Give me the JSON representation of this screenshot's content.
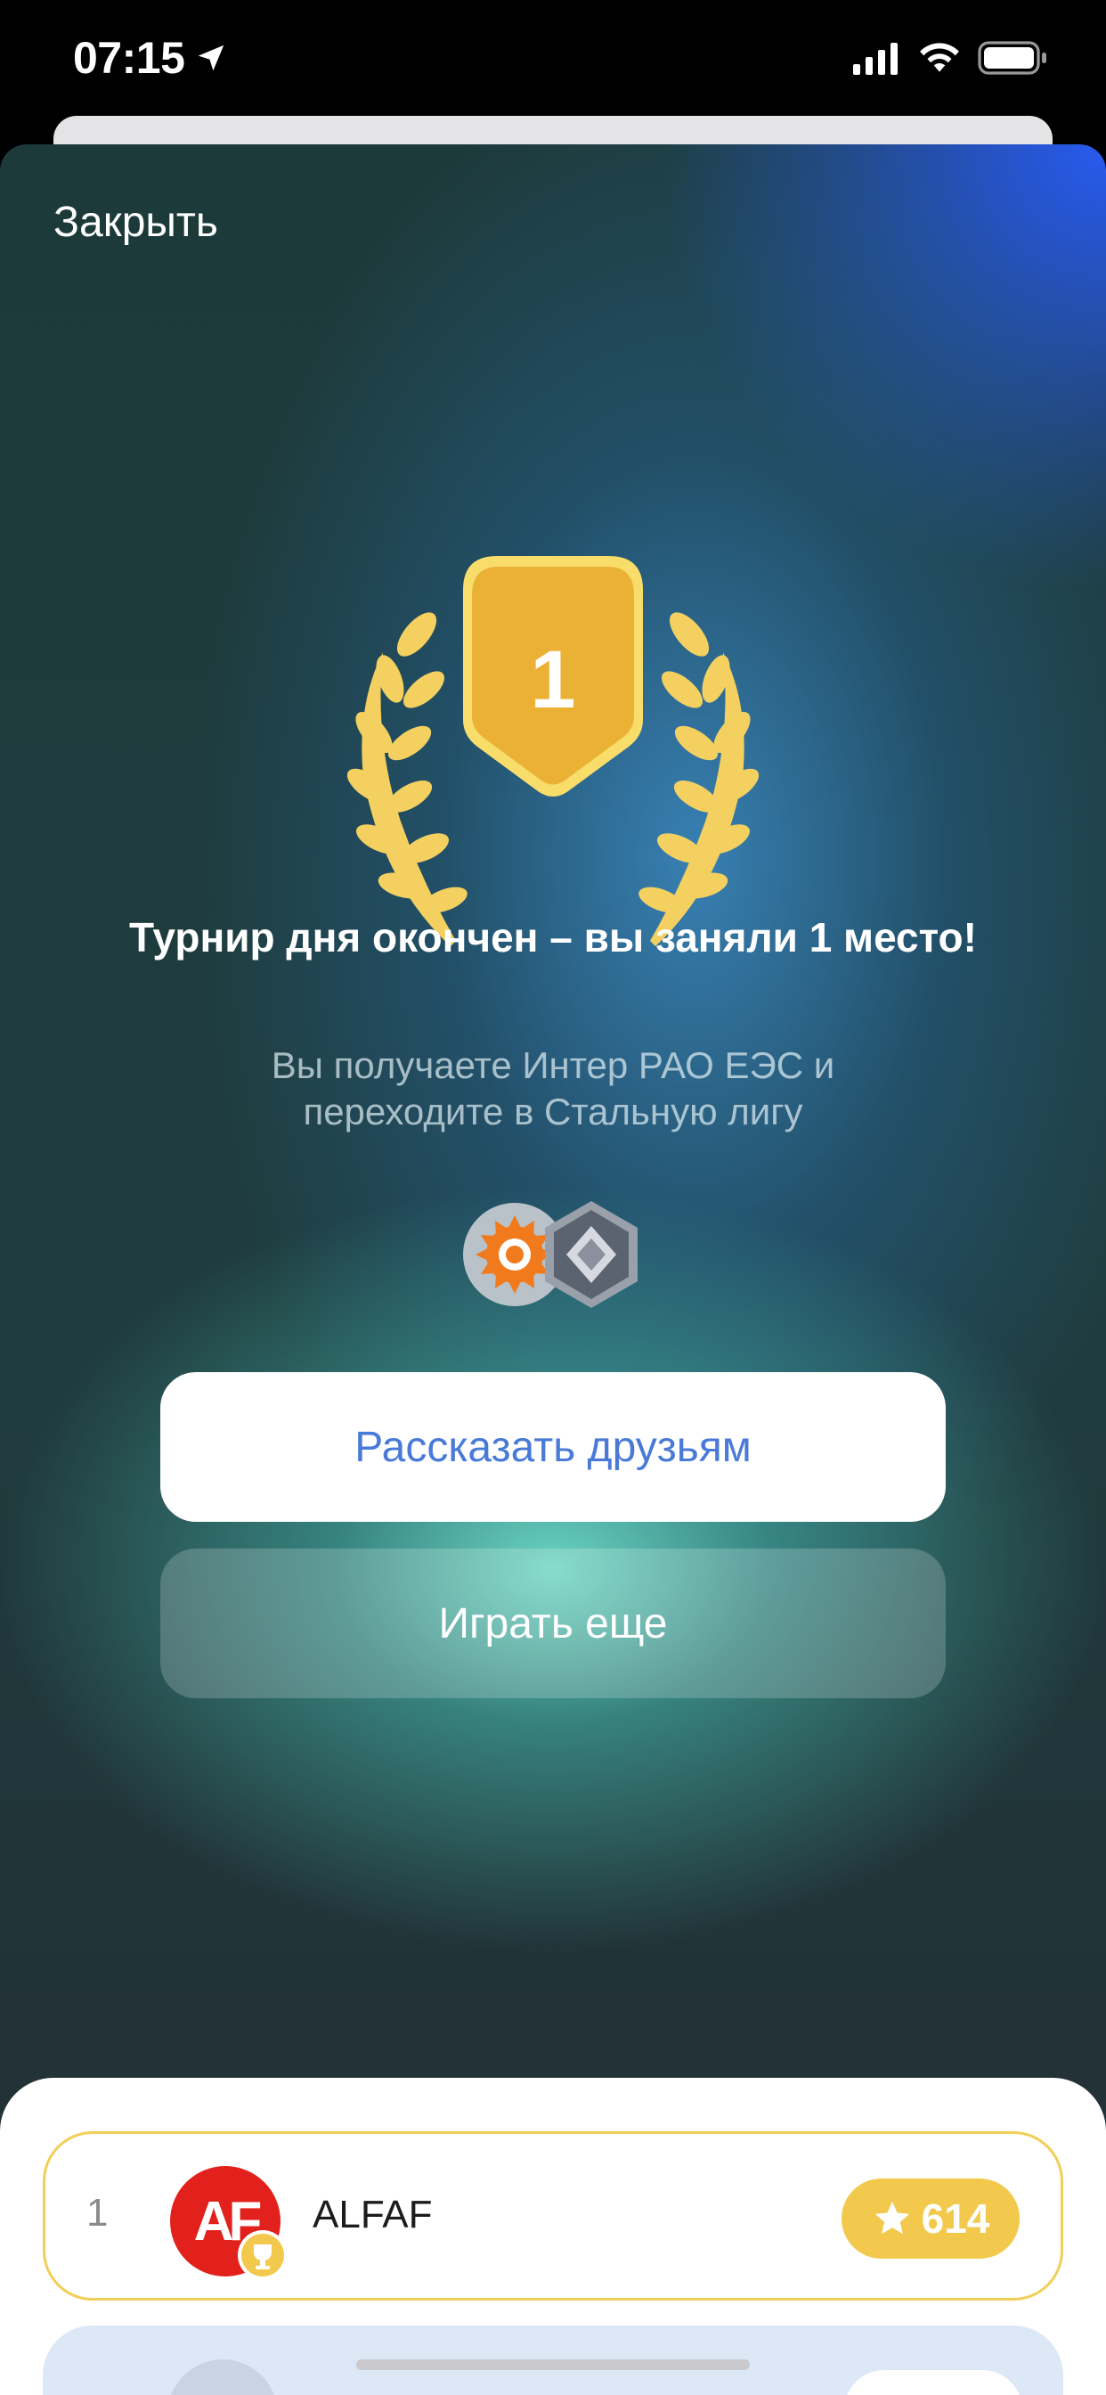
{
  "status_bar": {
    "time": "07:15",
    "icons": [
      "location-arrow-icon",
      "cellular-signal-icon",
      "wifi-icon",
      "battery-icon"
    ]
  },
  "modal": {
    "close_label": "Закрыть",
    "award": {
      "place": "1",
      "icon": "laurel-badge-icon",
      "color": "#f2c94c"
    },
    "title": "Турнир дня окончен – вы заняли 1 место!",
    "subtitle": "Вы получаете Интер РАО ЕЭС и переходите в Стальную лигу",
    "rewards": [
      "company-logo-icon",
      "steel-league-badge-icon"
    ],
    "buttons": {
      "share": "Рассказать друзьям",
      "play_again": "Играть еще"
    }
  },
  "leaderboard": {
    "rows": [
      {
        "rank": "1",
        "avatar_text": "AF",
        "name": "ALFAF",
        "score": "614"
      }
    ]
  },
  "colors": {
    "accent_blue": "#4a7ad8",
    "gold": "#f2c94c",
    "avatar_red": "#e2211c"
  }
}
